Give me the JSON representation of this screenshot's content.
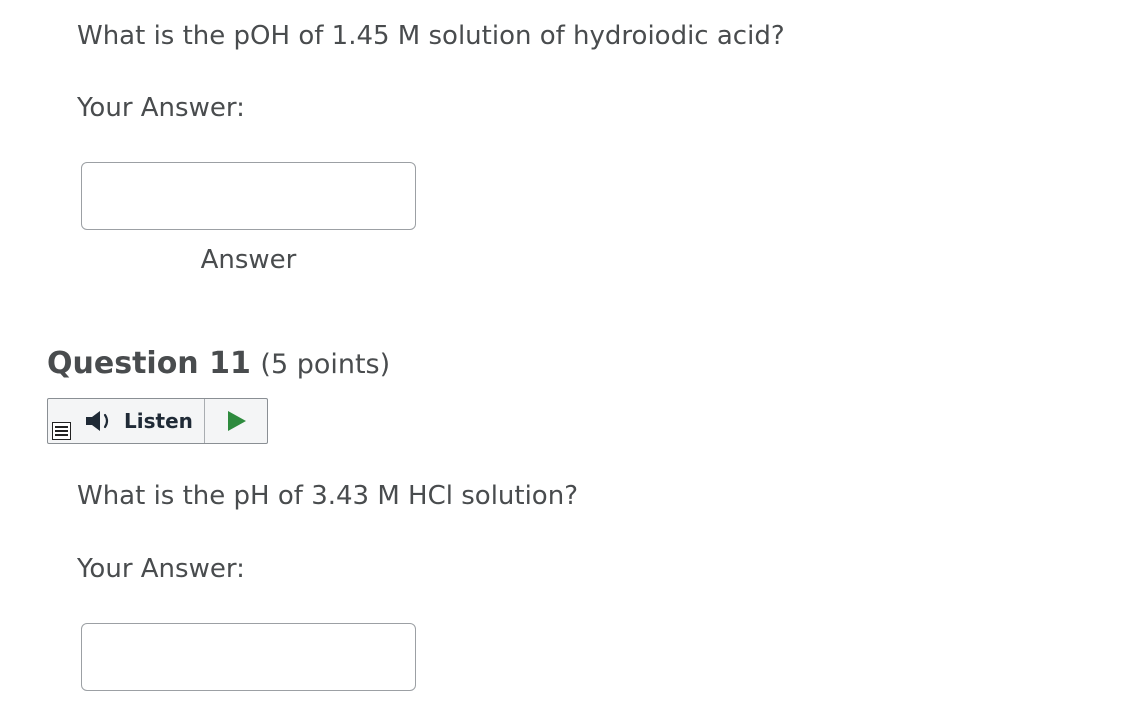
{
  "question10": {
    "prompt": "What is the pOH of 1.45 M solution of hydroiodic acid?",
    "your_answer_label": "Your Answer:",
    "answer_value": "",
    "answer_caption": "Answer"
  },
  "question11": {
    "heading": "Question 11",
    "points": "(5 points)",
    "listen": {
      "label": "Listen",
      "icons": [
        "menu-icon",
        "speaker-icon",
        "play-icon"
      ],
      "play_color": "#2e8b3e"
    },
    "prompt": "What is the pH of 3.43 M HCl solution?",
    "your_answer_label": "Your Answer:",
    "answer_value": ""
  },
  "colors": {
    "text": "#494c4e",
    "input_border": "#9ca0a4",
    "widget_border": "#8a8f94",
    "widget_bg": "#f4f5f6"
  }
}
